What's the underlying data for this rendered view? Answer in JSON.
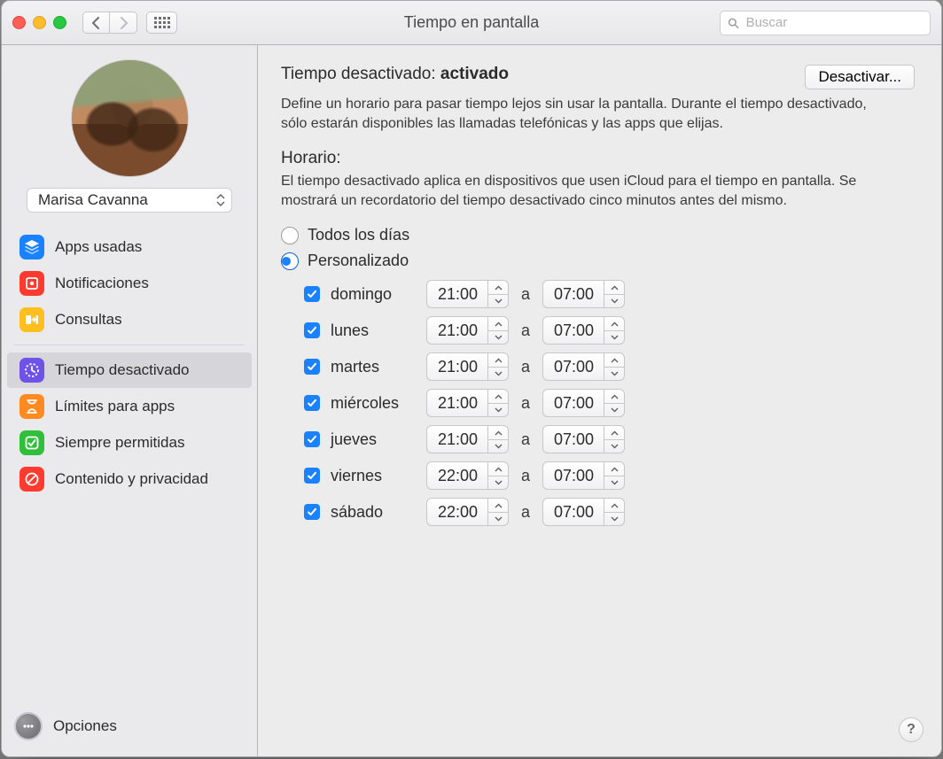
{
  "window": {
    "title": "Tiempo en pantalla"
  },
  "search": {
    "placeholder": "Buscar"
  },
  "user": {
    "name": "Marisa Cavanna"
  },
  "sidebar": {
    "items": [
      {
        "label": "Apps usadas",
        "icon": "layers-icon",
        "color": "#1a82ff"
      },
      {
        "label": "Notificaciones",
        "icon": "bell-icon",
        "color": "#ff3b30"
      },
      {
        "label": "Consultas",
        "icon": "pickup-icon",
        "color": "#ffbf1f"
      }
    ],
    "items2": [
      {
        "label": "Tiempo desactivado",
        "icon": "clock-icon",
        "color": "#6f52e8",
        "selected": true
      },
      {
        "label": "Límites para apps",
        "icon": "hourglass-icon",
        "color": "#ff8a1f"
      },
      {
        "label": "Siempre permitidas",
        "icon": "check-icon",
        "color": "#2fbf3a"
      },
      {
        "label": "Contenido y privacidad",
        "icon": "nosign-icon",
        "color": "#ff3b30"
      }
    ],
    "options_label": "Opciones"
  },
  "main": {
    "state_prefix": "Tiempo desactivado: ",
    "state_value": "activado",
    "disable_label": "Desactivar...",
    "desc": "Define un horario para pasar tiempo lejos sin usar la pantalla. Durante el tiempo desactivado, sólo estarán disponibles las llamadas telefónicas y las apps que elijas.",
    "schedule_title": "Horario:",
    "schedule_desc": "El tiempo desactivado aplica en dispositivos que usen iCloud para el tiempo en pantalla. Se mostrará un recordatorio del tiempo desactivado cinco minutos antes del mismo.",
    "radio_all": "Todos los días",
    "radio_custom": "Personalizado",
    "selected_radio": "custom",
    "sep": "a",
    "days": [
      {
        "name": "domingo",
        "checked": true,
        "from": "21:00",
        "to": "07:00"
      },
      {
        "name": "lunes",
        "checked": true,
        "from": "21:00",
        "to": "07:00"
      },
      {
        "name": "martes",
        "checked": true,
        "from": "21:00",
        "to": "07:00"
      },
      {
        "name": "miércoles",
        "checked": true,
        "from": "21:00",
        "to": "07:00"
      },
      {
        "name": "jueves",
        "checked": true,
        "from": "21:00",
        "to": "07:00"
      },
      {
        "name": "viernes",
        "checked": true,
        "from": "22:00",
        "to": "07:00"
      },
      {
        "name": "sábado",
        "checked": true,
        "from": "22:00",
        "to": "07:00"
      }
    ]
  },
  "help": "?"
}
